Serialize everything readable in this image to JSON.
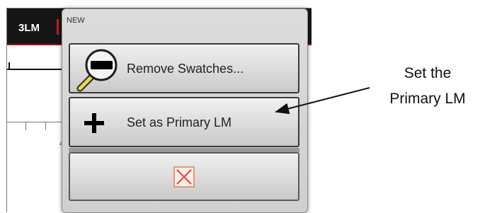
{
  "background_app": {
    "tab_label": "3LM",
    "ruler_number": "4"
  },
  "popup": {
    "title": "NEW",
    "items": [
      {
        "label": "Remove Swatches...",
        "icon": "magnifier-swatch-icon"
      },
      {
        "label": "Set as Primary LM",
        "icon": "plus-icon"
      },
      {
        "label": "",
        "icon": "close-x-icon"
      }
    ]
  },
  "annotation": {
    "line1": "Set the",
    "line2": "Primary LM"
  },
  "colors": {
    "close_icon": "#e84c3d",
    "topbar": "#161616",
    "accent_red": "#b30000"
  }
}
